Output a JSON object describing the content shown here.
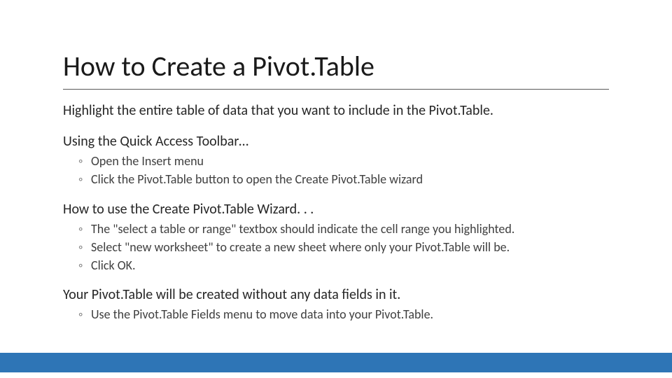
{
  "slide": {
    "title": "How to Create a Pivot.Table",
    "lead": "Highlight the entire table of data that you want to include in the Pivot.Table.",
    "section1": {
      "heading": "Using the Quick Access Toolbar…",
      "bullets": [
        "Open the Insert menu",
        "Click the Pivot.Table button to open the Create Pivot.Table wizard"
      ]
    },
    "section2": {
      "heading": "How to use the Create Pivot.Table Wizard. . .",
      "bullets": [
        "The \"select a table or range\" textbox should indicate the cell range you highlighted.",
        "Select \"new worksheet\" to create a new sheet where only your Pivot.Table will be.",
        "Click OK."
      ]
    },
    "section3": {
      "heading": "Your Pivot.Table will be created without any data fields in it.",
      "bullets": [
        "Use the Pivot.Table Fields menu to move data into your Pivot.Table."
      ]
    }
  },
  "colors": {
    "footer_bar": "#2E75B6",
    "rule": "#595959"
  }
}
